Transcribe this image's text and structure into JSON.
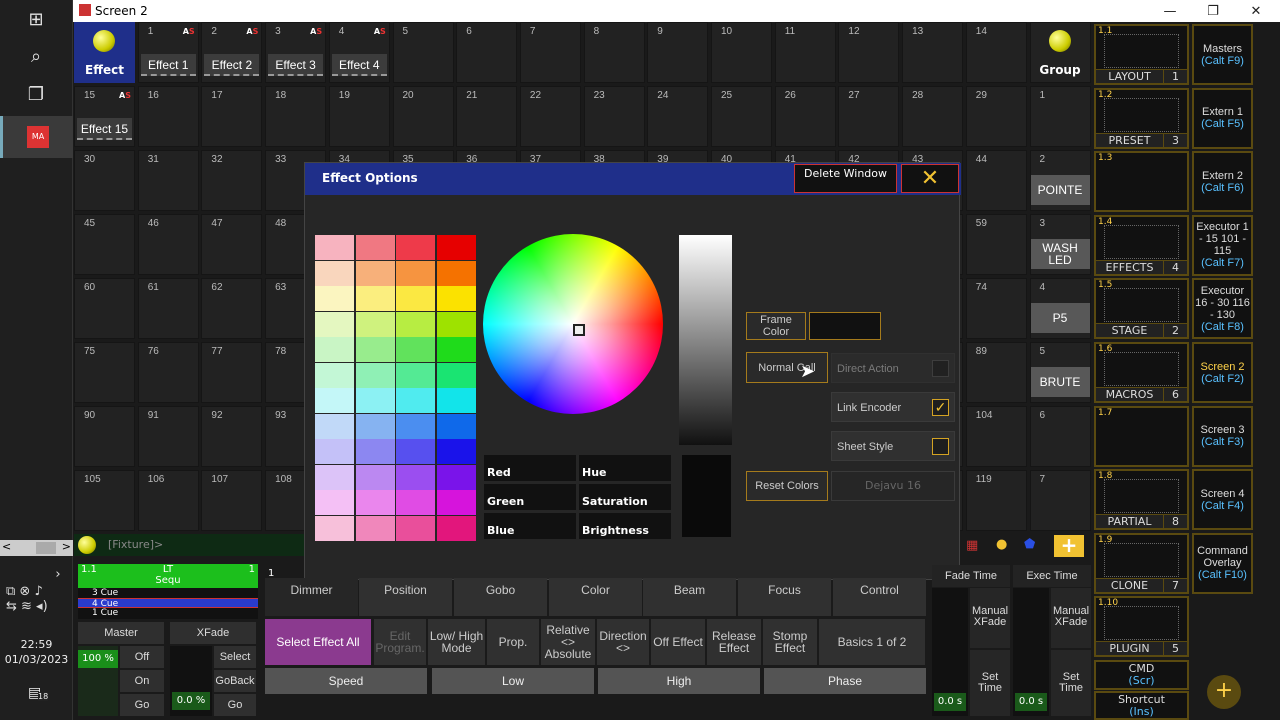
{
  "window": {
    "title": "Screen 2"
  },
  "taskbar": {
    "time": "22:59",
    "date": "01/03/2023",
    "notif_count": "18"
  },
  "grid": {
    "row1": [
      {
        "num": "1",
        "as": true,
        "label": "Effect 1"
      },
      {
        "num": "2",
        "as": true,
        "label": "Effect 2"
      },
      {
        "num": "3",
        "as": true,
        "label": "Effect 3"
      },
      {
        "num": "4",
        "as": true,
        "label": "Effect 4"
      },
      {
        "num": "5"
      },
      {
        "num": "6"
      },
      {
        "num": "7"
      },
      {
        "num": "8"
      },
      {
        "num": "9"
      },
      {
        "num": "10"
      },
      {
        "num": "11"
      },
      {
        "num": "12"
      },
      {
        "num": "13"
      },
      {
        "num": "14"
      }
    ],
    "row2": [
      {
        "num": "15",
        "as": true,
        "label": "Effect 15"
      },
      {
        "num": "16"
      },
      {
        "num": "17"
      },
      {
        "num": "18"
      },
      {
        "num": "19"
      },
      {
        "num": "20"
      },
      {
        "num": "21"
      },
      {
        "num": "22"
      },
      {
        "num": "23"
      },
      {
        "num": "24"
      },
      {
        "num": "25"
      },
      {
        "num": "26"
      },
      {
        "num": "27"
      },
      {
        "num": "28"
      },
      {
        "num": "29"
      }
    ],
    "row3": [
      "30",
      "31",
      "32",
      "33",
      "34",
      "35",
      "36",
      "37",
      "38",
      "39",
      "40",
      "41",
      "42",
      "43",
      "44"
    ],
    "row4": [
      "45",
      "46",
      "47",
      "48",
      "",
      "",
      "",
      "",
      "",
      "",
      "",
      "",
      "",
      "",
      "59"
    ],
    "row5": [
      "60",
      "61",
      "62",
      "63",
      "",
      "",
      "",
      "",
      "",
      "",
      "",
      "",
      "",
      "",
      "74"
    ],
    "row6": [
      "75",
      "76",
      "77",
      "78",
      "",
      "",
      "",
      "",
      "",
      "",
      "",
      "",
      "",
      "",
      "89"
    ],
    "row7": [
      "90",
      "91",
      "92",
      "93",
      "",
      "",
      "",
      "",
      "",
      "",
      "",
      "",
      "",
      "",
      "104"
    ],
    "row8": [
      "105",
      "106",
      "107",
      "108",
      "",
      "",
      "",
      "",
      "",
      "",
      "",
      "",
      "",
      "",
      "119"
    ],
    "effect_pool": "Effect",
    "group_pool": "Group",
    "group_col": [
      {
        "num": "1"
      },
      {
        "num": "2",
        "label": "POINTE"
      },
      {
        "num": "3",
        "label": "WASH LED"
      },
      {
        "num": "4",
        "label": "P5"
      },
      {
        "num": "5",
        "label": "BRUTE"
      },
      {
        "num": "6"
      },
      {
        "num": "7"
      }
    ]
  },
  "views": [
    {
      "num": "1.1",
      "name": "LAYOUT",
      "idx": "1"
    },
    {
      "num": "1.2",
      "name": "PRESET",
      "idx": "3"
    },
    {
      "num": "1.3",
      "name": "",
      "idx": ""
    },
    {
      "num": "1.4",
      "name": "EFFECTS",
      "idx": "4"
    },
    {
      "num": "1.5",
      "name": "STAGE",
      "idx": "2"
    },
    {
      "num": "1.6",
      "name": "MACROS",
      "idx": "6"
    },
    {
      "num": "1.7",
      "name": "",
      "idx": ""
    },
    {
      "num": "1.8",
      "name": "PARTIAL",
      "idx": "8"
    },
    {
      "num": "1.9",
      "name": "CLONE",
      "idx": "7"
    },
    {
      "num": "1.10",
      "name": "PLUGIN",
      "idx": "5"
    }
  ],
  "screens": [
    {
      "l1": "Masters",
      "l2": "(Calt F9)"
    },
    {
      "l1": "Extern 1",
      "l2": "(Calt F5)"
    },
    {
      "l1": "Extern 2",
      "l2": "(Calt F6)"
    },
    {
      "l1": "Executor 1 - 15 101 - 115",
      "l2": "(Calt F7)"
    },
    {
      "l1": "Executor 16 - 30 116 - 130",
      "l2": "(Calt F8)"
    },
    {
      "l1": "Screen 2",
      "l2": "(Calt F2)"
    },
    {
      "l1": "Screen 3",
      "l2": "(Calt F3)"
    },
    {
      "l1": "Screen 4",
      "l2": "(Calt F4)"
    },
    {
      "l1": "Command Overlay",
      "l2": "(Calt F10)"
    }
  ],
  "cmd": {
    "l1": "CMD",
    "l2": "(Scr)"
  },
  "shortcut": {
    "l1": "Shortcut",
    "l2": "(Ins)"
  },
  "dialog": {
    "title": "Effect  Options",
    "delete": "Delete Window",
    "frame_color": "Frame Color",
    "normal_call": "Normal Call",
    "direct_action": "Direct Action",
    "link_encoder": "Link Encoder",
    "sheet_style": "Sheet Style",
    "reset_colors": "Reset Colors",
    "font": "Dejavu 16",
    "fields": {
      "red": "Red",
      "hue": "Hue",
      "green": "Green",
      "saturation": "Saturation",
      "blue": "Blue",
      "brightness": "Brightness"
    },
    "palette": [
      [
        "#f7b3bf",
        "#f07882",
        "#ee3a4a",
        "#e60000"
      ],
      [
        "#f9d6bd",
        "#f7b07a",
        "#f69440",
        "#f57200"
      ],
      [
        "#fbf5c0",
        "#fbee7f",
        "#fbe842",
        "#fbe200"
      ],
      [
        "#e4f7c0",
        "#cff27e",
        "#b7ed42",
        "#9ee200"
      ],
      [
        "#c9f5c5",
        "#98ec8d",
        "#61e25c",
        "#1fdb1b"
      ],
      [
        "#c3f7d6",
        "#8ff0b5",
        "#54ea94",
        "#1ae472"
      ],
      [
        "#c4f7f8",
        "#8cf1f3",
        "#50ebef",
        "#12e4ea"
      ],
      [
        "#c1d9f8",
        "#86b3f1",
        "#4b8ef0",
        "#0f69ea"
      ],
      [
        "#c4c1f8",
        "#8c87f1",
        "#5750ef",
        "#1a13ea"
      ],
      [
        "#dcc3f8",
        "#bb88f1",
        "#9b4ef0",
        "#7a14ea"
      ],
      [
        "#f4c0f5",
        "#ea86ed",
        "#e04ce4",
        "#d614dc"
      ],
      [
        "#f7c0da",
        "#f087bb",
        "#e94f9b",
        "#e2167c"
      ]
    ]
  },
  "command_line": "[Fixture]>",
  "sequence": {
    "num": "1.1",
    "lt": "LT",
    "seq": "Sequ",
    "exec_num": "1",
    "cues": [
      "3 Cue",
      "4 Cue",
      "1 Cue"
    ]
  },
  "master": {
    "label": "Master",
    "pct": "100 %",
    "off": "Off",
    "on": "On",
    "go": "Go"
  },
  "xfade": {
    "label": "XFade",
    "pct": "0.0 %",
    "select": "Select",
    "goback": "GoBack",
    "go": "Go"
  },
  "tabs": {
    "num": "1",
    "items": [
      "Dimmer",
      "Position",
      "Gobo",
      "Color",
      "Beam",
      "Focus",
      "Control"
    ]
  },
  "buttons": [
    "Select Effect All",
    "Edit Program.",
    "Low/ High Mode",
    "Prop.",
    "Relative <> Absolute",
    "Direction <>",
    "Off Effect",
    "Release Effect",
    "Stomp Effect",
    "Basics 1 of 2"
  ],
  "encoders": [
    "Speed",
    "Low",
    "High",
    "Phase"
  ],
  "fades": {
    "fade_time": "Fade Time",
    "exec_time": "Exec Time",
    "manual": "Manual XFade",
    "set": "Set Time",
    "val1": "0.0 s",
    "val2": "0.0 s"
  }
}
